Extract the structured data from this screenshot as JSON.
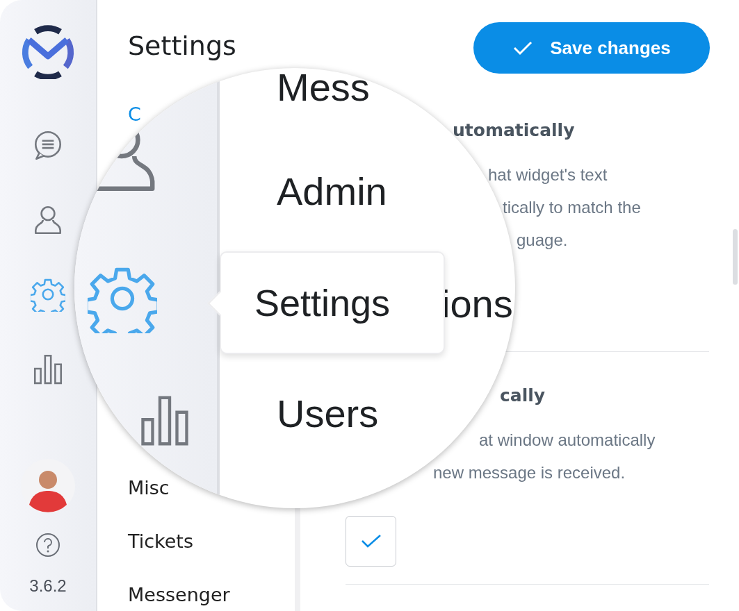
{
  "sidebar": {
    "nav": [
      {
        "kind": "chat",
        "selected": false
      },
      {
        "kind": "user",
        "selected": false
      },
      {
        "kind": "gear",
        "selected": true
      },
      {
        "kind": "bars",
        "selected": false
      }
    ],
    "version": "3.6.2"
  },
  "header": {
    "title": "Settings",
    "save_button": "Save changes"
  },
  "settings_nav": {
    "items": [
      {
        "label": "C",
        "selected": true
      },
      {
        "label": "Misc",
        "selected": false
      },
      {
        "label": "Tickets",
        "selected": false
      },
      {
        "label": "Messenger",
        "selected": false
      }
    ]
  },
  "content": {
    "sections": [
      {
        "title": "utomatically",
        "description": [
          "hat widget's text",
          "tically to match the",
          "guage."
        ]
      },
      {
        "title": "cally",
        "description": [
          "at window automatically",
          "new message is received."
        ],
        "checkbox": {
          "checked": true
        }
      }
    ]
  },
  "magnifier": {
    "labels": [
      "Mess",
      "Admin",
      "ions",
      "Users"
    ],
    "tooltip": "Settings"
  }
}
